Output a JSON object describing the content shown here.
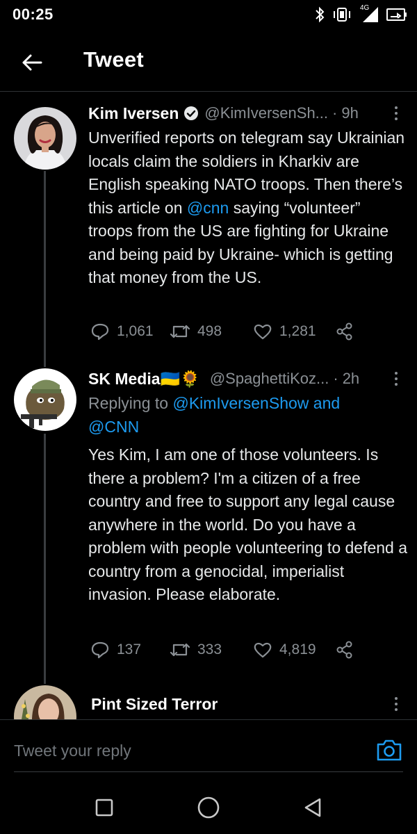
{
  "status_bar": {
    "time": "00:25",
    "network": "4G",
    "icons": [
      "bluetooth-icon",
      "vibrate-icon",
      "signal-icon",
      "battery-icon"
    ]
  },
  "header": {
    "title": "Tweet",
    "back_icon": "arrow-left-icon"
  },
  "tweets": [
    {
      "name": "Kim Iversen",
      "verified": true,
      "handle": "@KimIversenSh...",
      "time": "9h",
      "body_parts": [
        "Unverified reports on telegram say Ukrainian locals claim the soldiers in Kharkiv are English speaking NATO troops. Then there’s this article on ",
        "@cnn",
        " saying “volunteer” troops from the US are fighting for Ukraine and being paid by Ukraine- which is getting that money from the US."
      ],
      "replies": "1,061",
      "retweets": "498",
      "likes": "1,281"
    },
    {
      "name": "SK Media🇺🇦🌻",
      "handle": "@SpaghettiKoz...",
      "time": "2h",
      "replying_label": "Replying to ",
      "replying_mention1": "@KimIversenShow",
      "replying_and": " and",
      "replying_mention2": "@CNN",
      "body": "Yes Kim, I am one of those volunteers. Is there a problem? I'm a citizen of a free country and free to support any legal cause anywhere in the world. Do you have a problem with people volunteering to defend a country from a genocidal, imperialist invasion. Please elaborate.",
      "replies": "137",
      "retweets": "333",
      "likes": "4,819"
    },
    {
      "name": "Pint Sized Terror"
    }
  ],
  "composer": {
    "placeholder": "Tweet your reply",
    "camera_icon": "camera-icon"
  },
  "navbar": {
    "icons": [
      "recents-square-icon",
      "home-circle-icon",
      "back-triangle-icon"
    ]
  },
  "colors": {
    "background": "#000000",
    "link": "#1d9bf0",
    "muted": "#8b9095",
    "text": "#e7e9ea"
  }
}
